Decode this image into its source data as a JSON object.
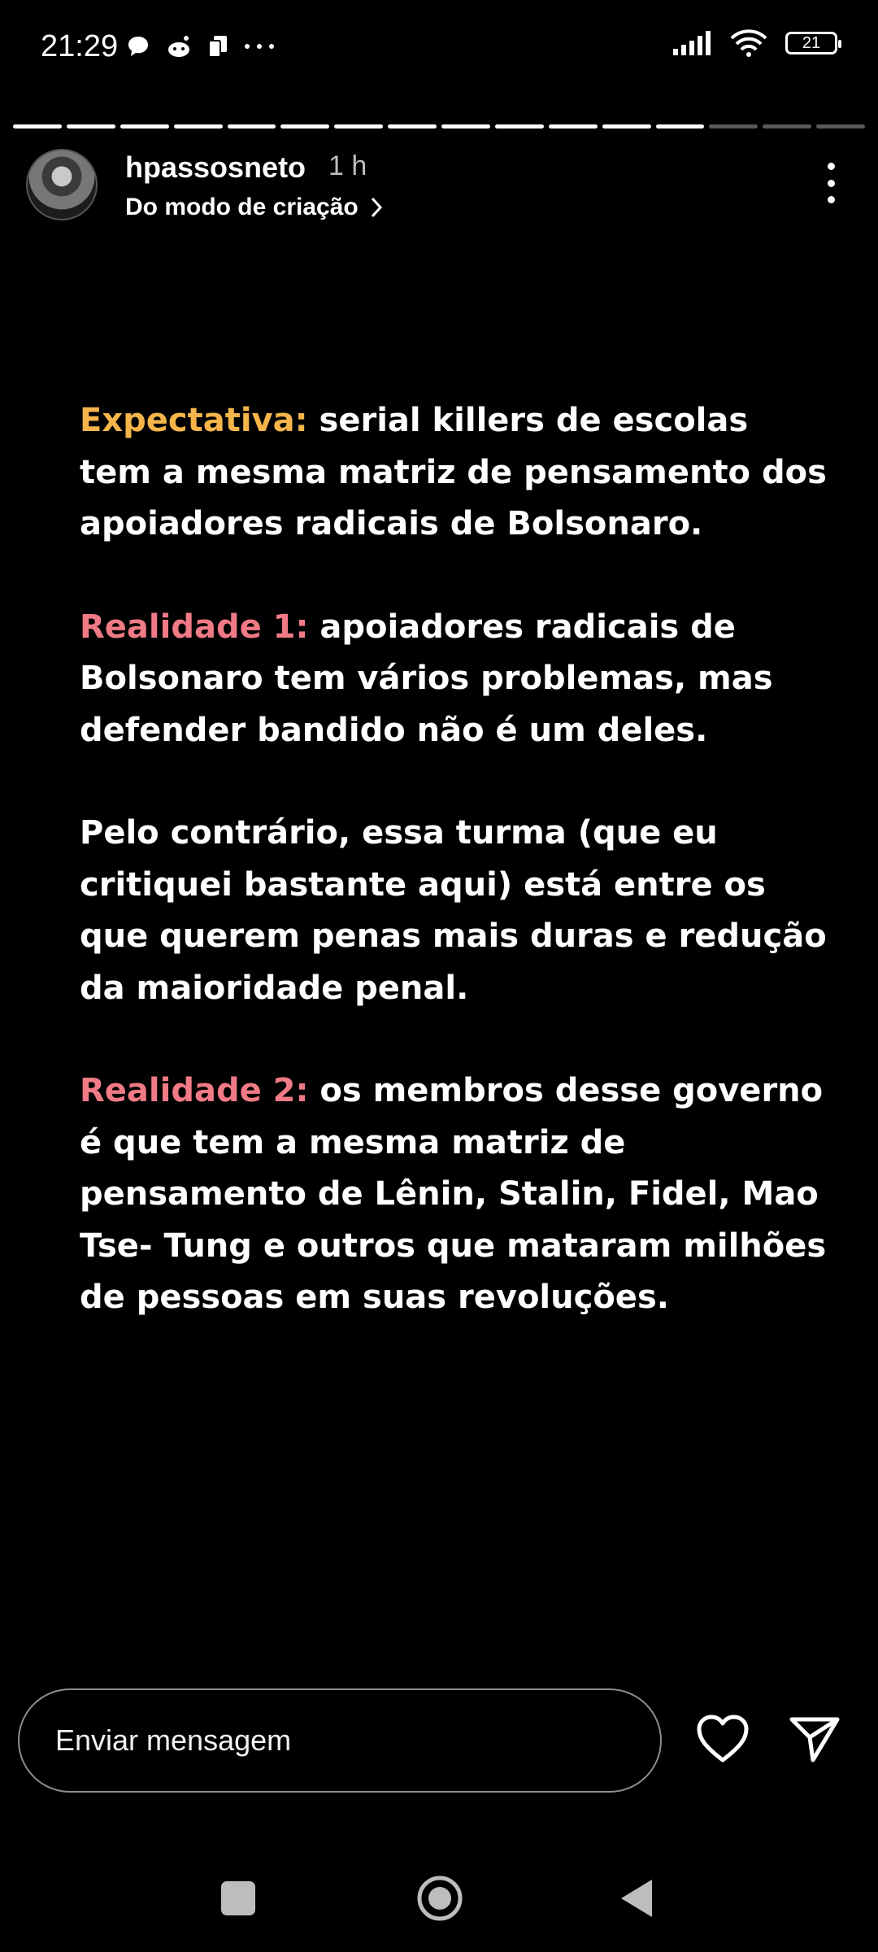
{
  "status_bar": {
    "time": "21:29",
    "battery": "21"
  },
  "story": {
    "progress_total": 16,
    "progress_done": 13,
    "username": "hpassosneto",
    "time_ago": "1 h",
    "subtitle": "Do modo de criação",
    "paragraphs": {
      "p1_label": "Expectativa:",
      "p1_text": " serial killers de escolas tem a mesma matriz de pensamento dos apoiadores radicais de Bolsonaro.",
      "p2_label": "Realidade 1:",
      "p2_text": " apoiadores radicais de Bolsonaro tem vários problemas, mas defender bandido não é um deles.",
      "p3_text": "Pelo contrário, essa turma (que eu critiquei bastante aqui) está entre os que querem penas mais duras e redução da maioridade penal.",
      "p4_label": "Realidade 2:",
      "p4_text": " os membros desse governo é que tem a mesma matriz de pensamento de Lênin, Stalin, Fidel, Mao Tse- Tung e outros que mataram milhões de pessoas em suas revoluções."
    },
    "label_colors": {
      "expectativa": "#f5b54a",
      "realidade": "#f07a86"
    }
  },
  "footer": {
    "message_placeholder": "Enviar mensagem",
    "like_icon": "heart-icon",
    "send_icon": "paper-plane-icon"
  }
}
